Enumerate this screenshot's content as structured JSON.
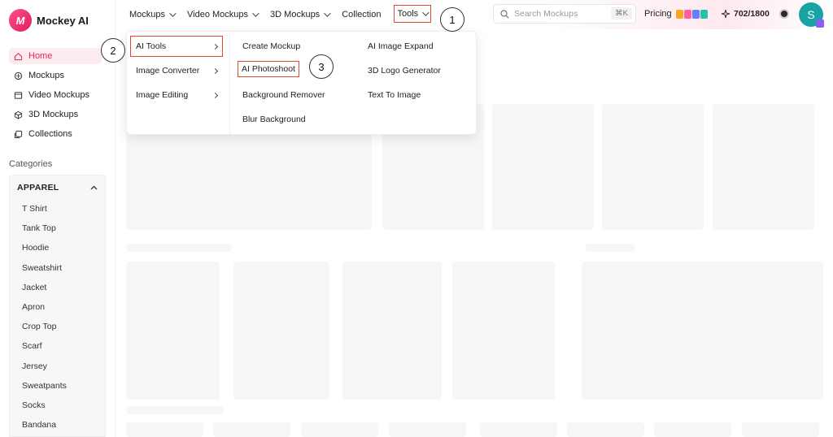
{
  "brand": {
    "logo_mark": "M",
    "name": "Mockey AI"
  },
  "sidebar": {
    "nav": [
      {
        "label": "Home",
        "icon": "home-icon"
      },
      {
        "label": "Mockups",
        "icon": "mockups-icon"
      },
      {
        "label": "Video Mockups",
        "icon": "video-icon"
      },
      {
        "label": "3D Mockups",
        "icon": "cube-icon"
      },
      {
        "label": "Collections",
        "icon": "collections-icon"
      }
    ],
    "categories_title": "Categories",
    "category_group": "APPAREL",
    "category_items": [
      "T Shirt",
      "Tank Top",
      "Hoodie",
      "Sweatshirt",
      "Jacket",
      "Apron",
      "Crop Top",
      "Scarf",
      "Jersey",
      "Sweatpants",
      "Socks",
      "Bandana"
    ]
  },
  "topbar": {
    "menu": [
      "Mockups",
      "Video Mockups",
      "3D Mockups",
      "Collection",
      "Tools"
    ],
    "search_placeholder": "Search Mockups",
    "search_shortcut": "⌘K",
    "pricing_label": "Pricing",
    "credits": "702/1800",
    "avatar_initial": "S"
  },
  "dropdown": {
    "categories": [
      "AI Tools",
      "Image Converter",
      "Image Editing"
    ],
    "col2": [
      "Create Mockup",
      "AI Photoshoot",
      "Background Remover",
      "Blur Background"
    ],
    "col3": [
      "AI Image Expand",
      "3D Logo Generator",
      "Text To Image"
    ]
  },
  "steps": [
    "1",
    "2",
    "3"
  ],
  "colors": {
    "accent": "#e0245e",
    "highlight_box": "#e04a2c",
    "avatar": "#1aa3a3"
  }
}
